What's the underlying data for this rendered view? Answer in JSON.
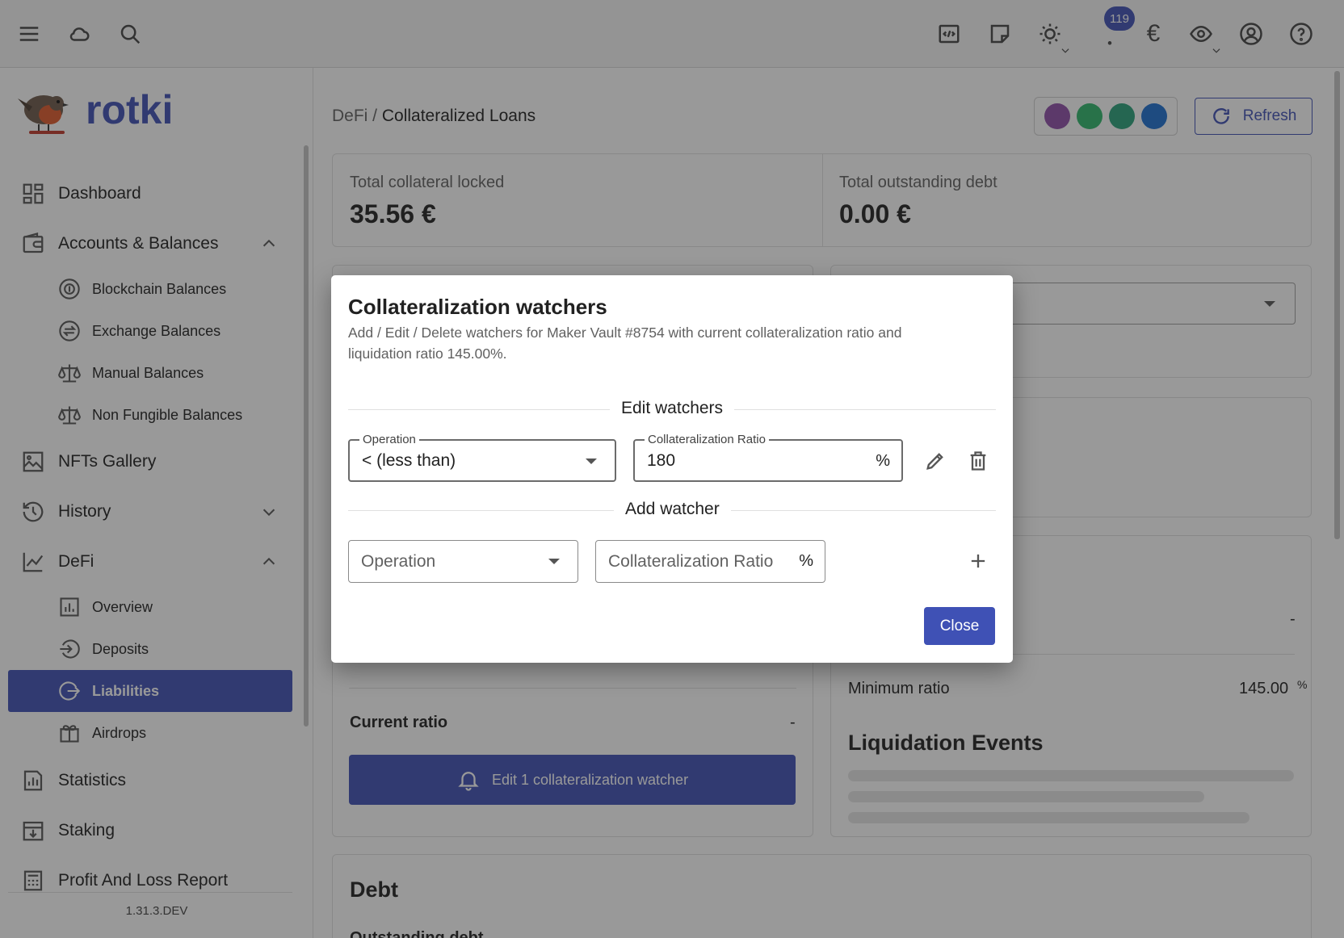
{
  "topbar": {
    "notification_count": "119",
    "currency_symbol": "€",
    "icons": [
      "menu-icon",
      "cloud-icon",
      "search-icon",
      "code-icon",
      "note-icon",
      "theme-icon",
      "notifications-icon",
      "currency-icon",
      "privacy-eye-icon",
      "account-icon",
      "help-icon"
    ]
  },
  "sidebar": {
    "logo_text": "rotki",
    "version": "1.31.3.DEV",
    "items": [
      {
        "label": "Dashboard"
      },
      {
        "label": "Accounts & Balances"
      },
      {
        "label": "Blockchain Balances"
      },
      {
        "label": "Exchange Balances"
      },
      {
        "label": "Manual Balances"
      },
      {
        "label": "Non Fungible Balances"
      },
      {
        "label": "NFTs Gallery"
      },
      {
        "label": "History"
      },
      {
        "label": "DeFi"
      },
      {
        "label": "Overview"
      },
      {
        "label": "Deposits"
      },
      {
        "label": "Liabilities"
      },
      {
        "label": "Airdrops"
      },
      {
        "label": "Statistics"
      },
      {
        "label": "Staking"
      },
      {
        "label": "Profit And Loss Report"
      }
    ]
  },
  "main": {
    "breadcrumb": {
      "parent": "DeFi /",
      "current": "Collateralized Loans"
    },
    "refresh_label": "Refresh",
    "protocol_colors": [
      "#8f4ea8",
      "#2fb86b",
      "#2aa17a",
      "#1c6fd1"
    ],
    "total_collateral_label": "Total collateral locked",
    "total_collateral_value": "35.56 €",
    "total_debt_label": "Total outstanding debt",
    "total_debt_value": "0.00 €",
    "right_dash": "-",
    "minimum_ratio_label": "Minimum ratio",
    "minimum_ratio_value": "145.00",
    "minimum_ratio_unit": "%",
    "liquidation_events_title": "Liquidation Events",
    "current_ratio_label": "Current ratio",
    "current_ratio_value": "-",
    "watcher_button_label": "Edit 1 collateralization watcher",
    "debt_title": "Debt",
    "outstanding_debt_label": "Outstanding debt"
  },
  "dialog": {
    "title": "Collateralization watchers",
    "subtitle": "Add / Edit / Delete watchers for Maker Vault #8754 with current collateralization ratio and liquidation ratio 145.00%.",
    "edit_section": "Edit watchers",
    "operation_legend": "Operation",
    "operation_value": "< (less than)",
    "ratio_legend": "Collateralization Ratio",
    "ratio_value": "180",
    "percent": "%",
    "add_section": "Add watcher",
    "operation_placeholder": "Operation",
    "ratio_placeholder": "Collateralization Ratio",
    "close_label": "Close"
  }
}
